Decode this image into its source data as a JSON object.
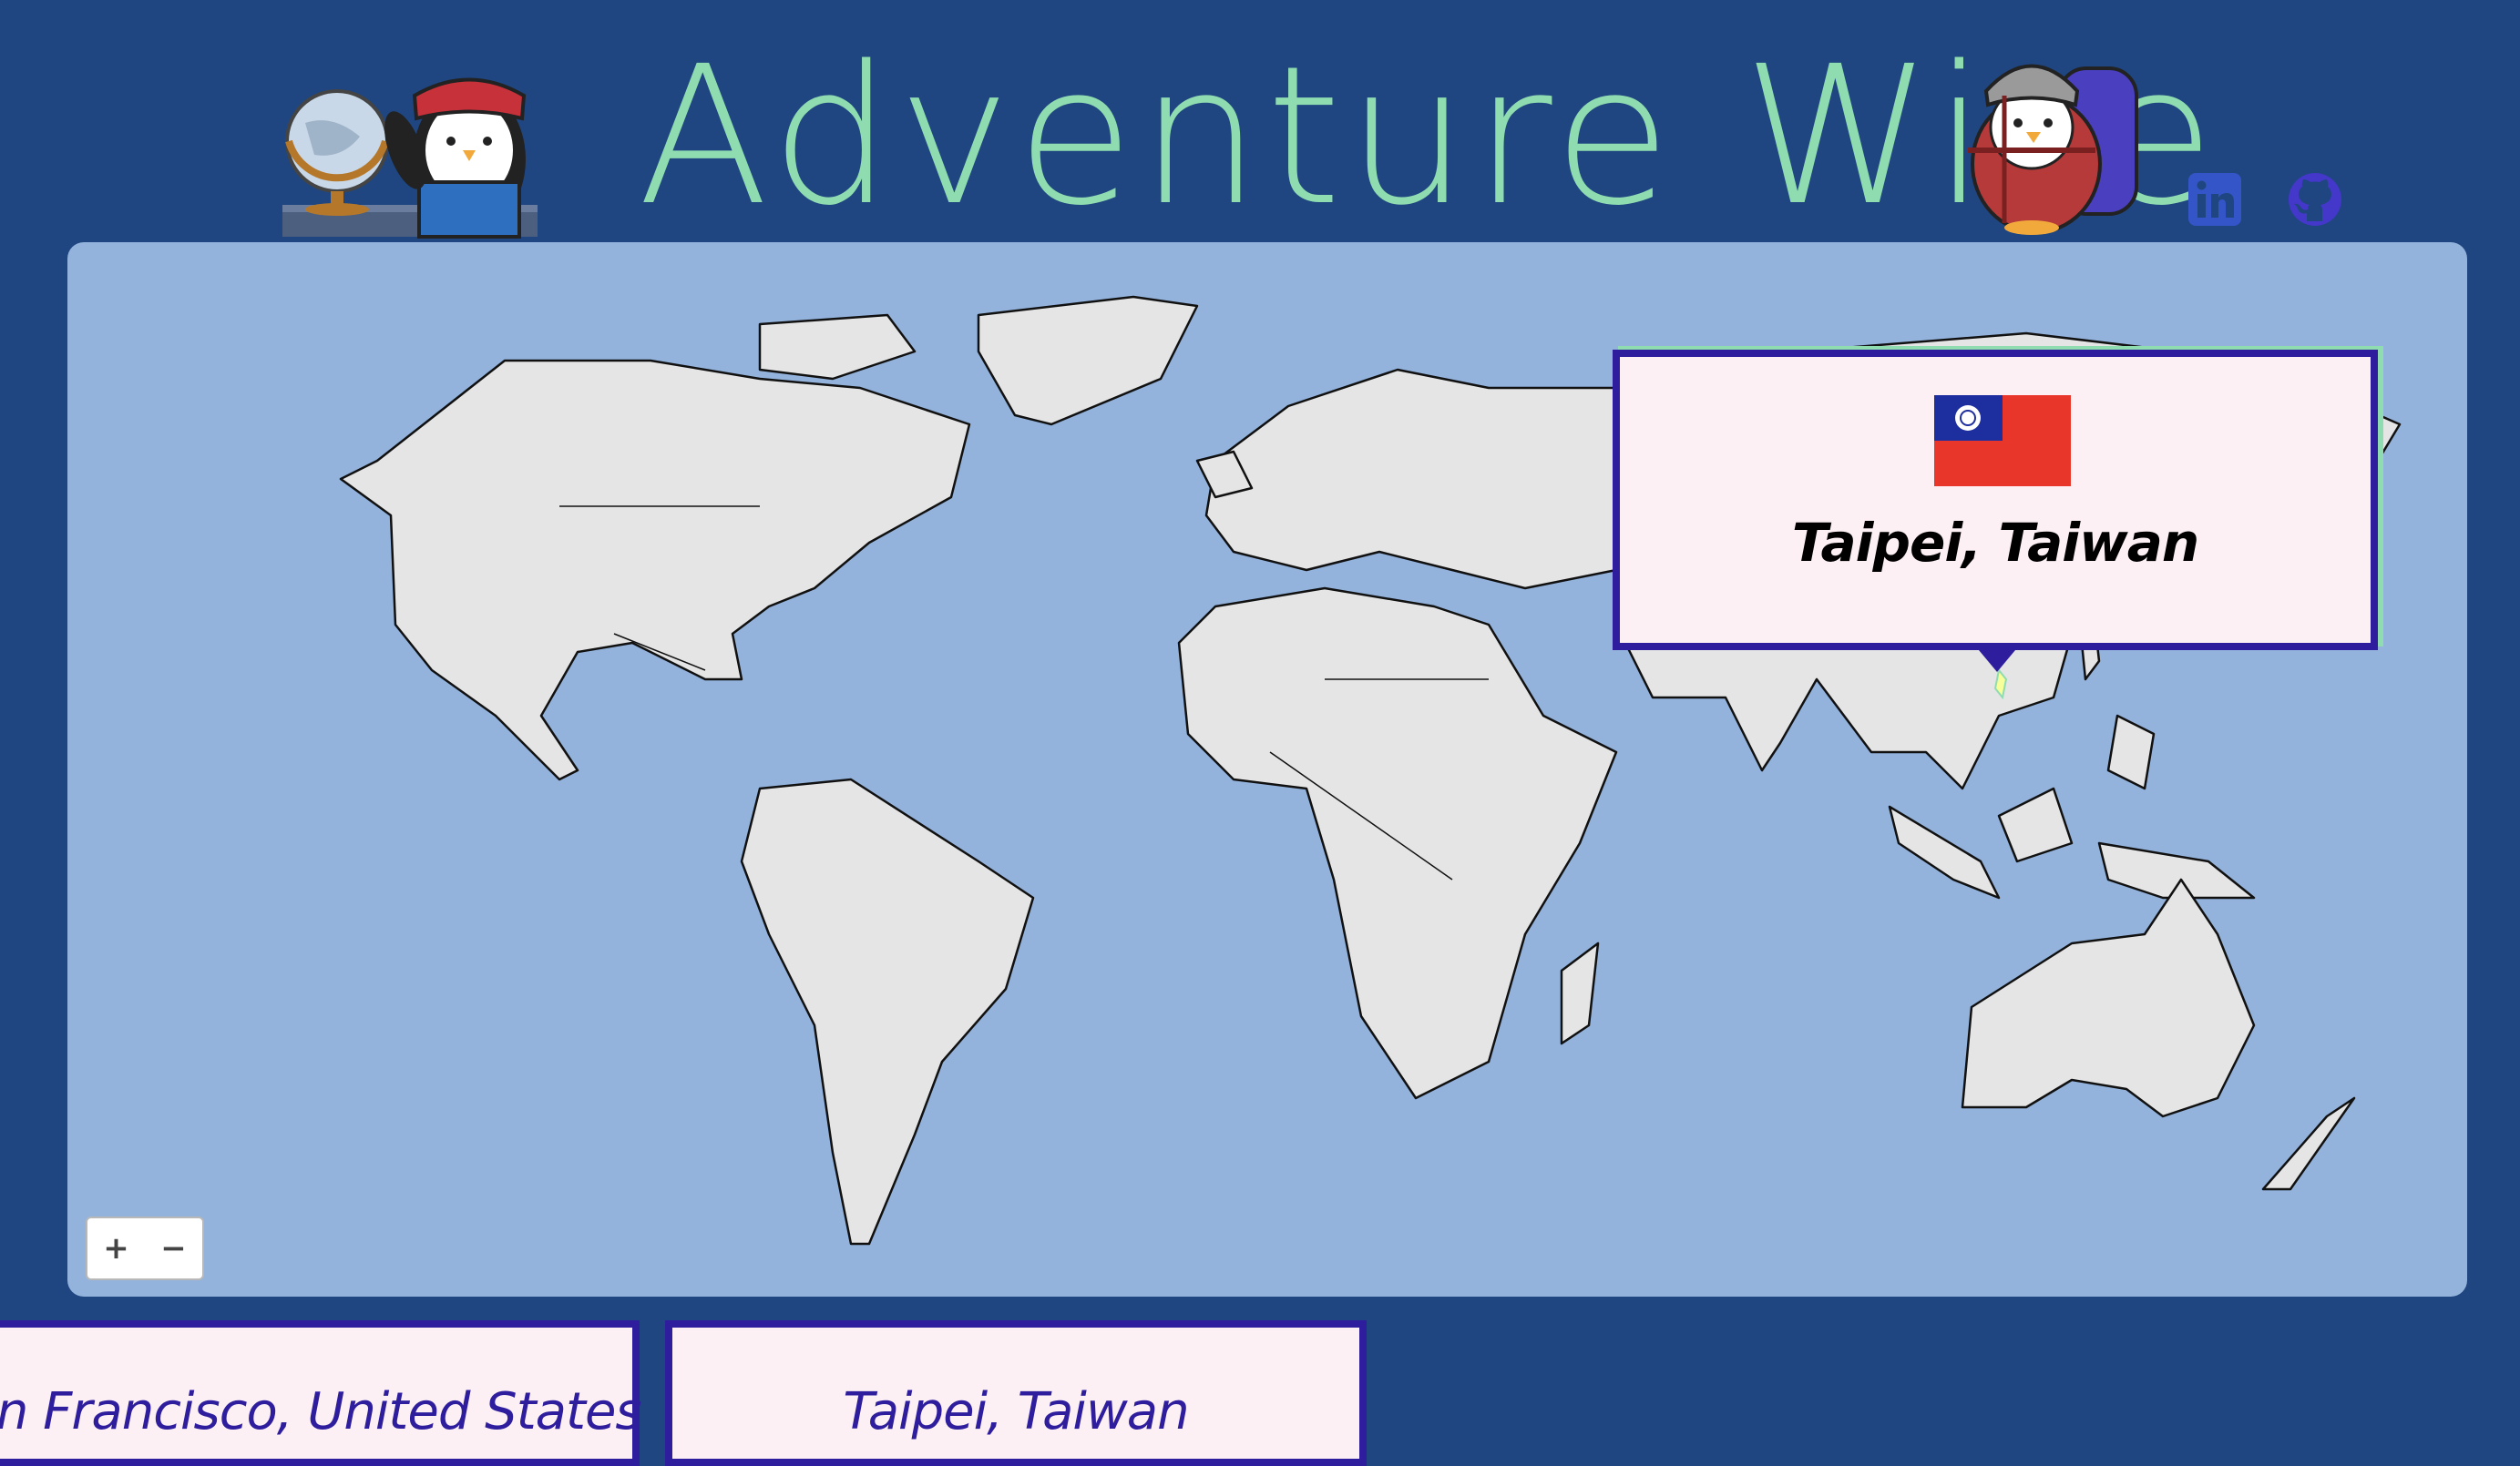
{
  "header": {
    "title": "Adventure Wise",
    "left_logo_icon": "penguin-with-globe-icon",
    "right_logo_icon": "penguin-backpacker-icon"
  },
  "social": {
    "linkedin_icon": "linkedin-icon",
    "github_icon": "github-icon"
  },
  "map": {
    "zoom_in_label": "+",
    "zoom_out_label": "−",
    "popup": {
      "flag_icon": "taiwan-flag-icon",
      "city": "Taipei, Taiwan"
    }
  },
  "cards": [
    {
      "label": "San Francisco, United States"
    },
    {
      "label": "Taipei, Taiwan"
    }
  ],
  "colors": {
    "background": "#1f4680",
    "title": "#8fdcb0",
    "ocean": "#93b3dc",
    "land": "#e5e5e5",
    "accent": "#2e1e9e",
    "card": "#fcf0f4"
  }
}
